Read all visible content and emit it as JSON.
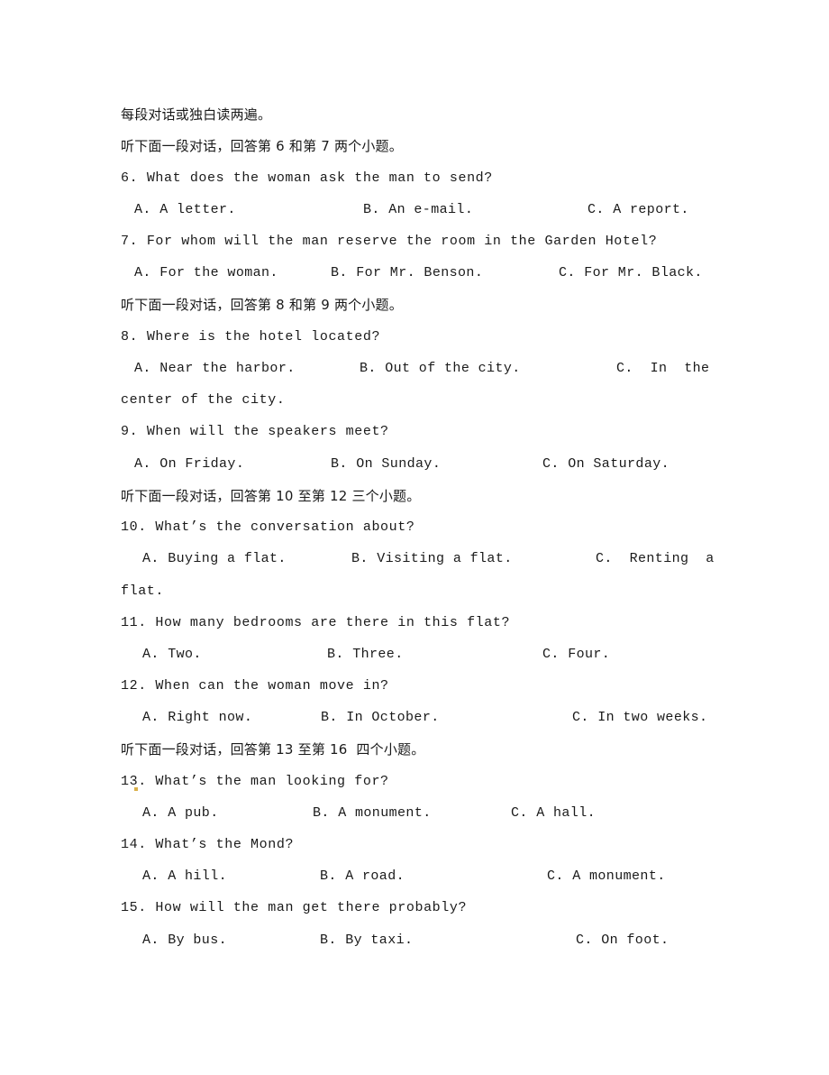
{
  "document": {
    "intro": "每段对话或独白读两遍。",
    "sections": [
      {
        "instruction": "听下面一段对话，回答第 6 和第 7 两个小题。",
        "questions": [
          {
            "number": "6.",
            "text": "What does the woman ask the man to send?",
            "options": {
              "A": "A. A letter.",
              "B": "B. An e-mail.",
              "C": "C. A report."
            }
          },
          {
            "number": "7.",
            "text": "For whom will the man reserve the room in the Garden Hotel?",
            "options": {
              "A": "A. For the woman.",
              "B": "B. For Mr. Benson.",
              "C": "C. For Mr. Black."
            }
          }
        ]
      },
      {
        "instruction": "听下面一段对话，回答第 8 和第 9 两个小题。",
        "questions": [
          {
            "number": "8.",
            "text": "Where is the hotel located?",
            "options": {
              "A": "A. Near the harbor.",
              "B": "B. Out of the city.",
              "C": "C.  In  the",
              "C_cont": "center of the city."
            }
          },
          {
            "number": "9.",
            "text": "When will the speakers meet?",
            "options": {
              "A": "A. On Friday.",
              "B": "B. On Sunday.",
              "C": "C. On Saturday."
            }
          }
        ]
      },
      {
        "instruction": "听下面一段对话，回答第 10 至第 12 三个小题。",
        "questions": [
          {
            "number": "10.",
            "text": "What’s the conversation about?",
            "options": {
              "A": "A. Buying a flat.",
              "B": "B. Visiting a flat.",
              "C": "C.  Renting  a",
              "C_cont": "flat."
            }
          },
          {
            "number": "11.",
            "text": "How many bedrooms are there in this flat?",
            "options": {
              "A": "A. Two.",
              "B": "B. Three.",
              "C": "C. Four."
            }
          },
          {
            "number": "12.",
            "text": "When can the woman move in?",
            "options": {
              "A": "A. Right now.",
              "B": "B. In October.",
              "C": "C. In two weeks."
            }
          }
        ]
      },
      {
        "instruction": "听下面一段对话，回答第 13 至第 16  四个小题。",
        "questions": [
          {
            "number": "13.",
            "text": "What’s the man looking for?",
            "options": {
              "A": "A. A pub.",
              "B": "B. A monument.",
              "C": "C. A hall."
            }
          },
          {
            "number": "14.",
            "text": "What’s the Mond?",
            "options": {
              "A": "A. A hill.",
              "B": "B. A road.",
              "C": "C. A monument."
            }
          },
          {
            "number": "15.",
            "text": "How will the man get there probably?",
            "options": {
              "A": "A. By bus.",
              "B": "B. By taxi.",
              "C": "C. On foot."
            }
          }
        ]
      }
    ]
  }
}
